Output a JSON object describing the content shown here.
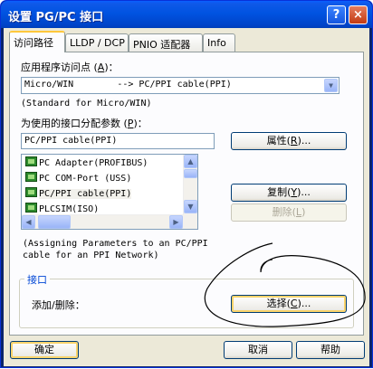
{
  "window": {
    "title": "设置 PG/PC 接口",
    "help_glyph": "?",
    "close_glyph": "×"
  },
  "tabs": [
    {
      "label": "访问路径"
    },
    {
      "label": "LLDP / DCP"
    },
    {
      "label": "PNIO 适配器"
    },
    {
      "label": "Info"
    }
  ],
  "access_point": {
    "label_prefix": "应用程序访问点 (",
    "label_key": "A",
    "label_suffix": ")：",
    "value": "Micro/WIN        --> PC/PPI cable(PPI)",
    "note": "(Standard for Micro/WIN)"
  },
  "interface_params": {
    "label_prefix": "为使用的接口分配参数 (",
    "label_key": "P",
    "label_suffix": ")：",
    "value": "PC/PPI cable(PPI)"
  },
  "interface_list": [
    {
      "label": "PC Adapter(PROFIBUS)"
    },
    {
      "label": "PC COM-Port (USS)"
    },
    {
      "label": "PC/PPI cable(PPI)"
    },
    {
      "label": "PLCSIM(ISO)"
    }
  ],
  "buttons": {
    "properties": {
      "prefix": "属性(",
      "key": "R",
      "suffix": ")..."
    },
    "copy": {
      "prefix": "复制(",
      "key": "Y",
      "suffix": ")..."
    },
    "delete": {
      "prefix": "删除(",
      "key": "L",
      "suffix": ")"
    },
    "select": {
      "prefix": "选择(",
      "key": "C",
      "suffix": ")..."
    },
    "ok": "确定",
    "cancel": "取消",
    "help": "帮助"
  },
  "description": "(Assigning Parameters to an PC/PPI\ncable for an PPI Network)",
  "interface_group": {
    "title": "接口",
    "add_remove_label": "添加/删除："
  },
  "scrollbar_glyphs": {
    "up": "▲",
    "down": "▼",
    "left": "◀",
    "right": "▶",
    "combo": "▼"
  }
}
